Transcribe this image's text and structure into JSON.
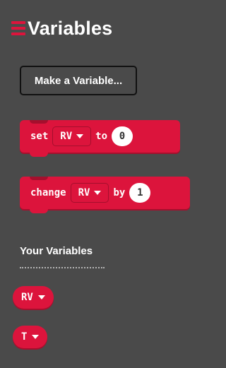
{
  "header": {
    "title": "Variables",
    "icon": "list-icon",
    "accent": "#dc143c"
  },
  "toolbox": {
    "make_variable_label": "Make a Variable...",
    "set_block": {
      "keyword": "set",
      "variable": "RV",
      "to_keyword": "to",
      "value": "0"
    },
    "change_block": {
      "keyword": "change",
      "variable": "RV",
      "by_keyword": "by",
      "value": "1"
    }
  },
  "your_variables": {
    "heading": "Your Variables",
    "items": [
      {
        "name": "RV"
      },
      {
        "name": "T"
      }
    ]
  }
}
